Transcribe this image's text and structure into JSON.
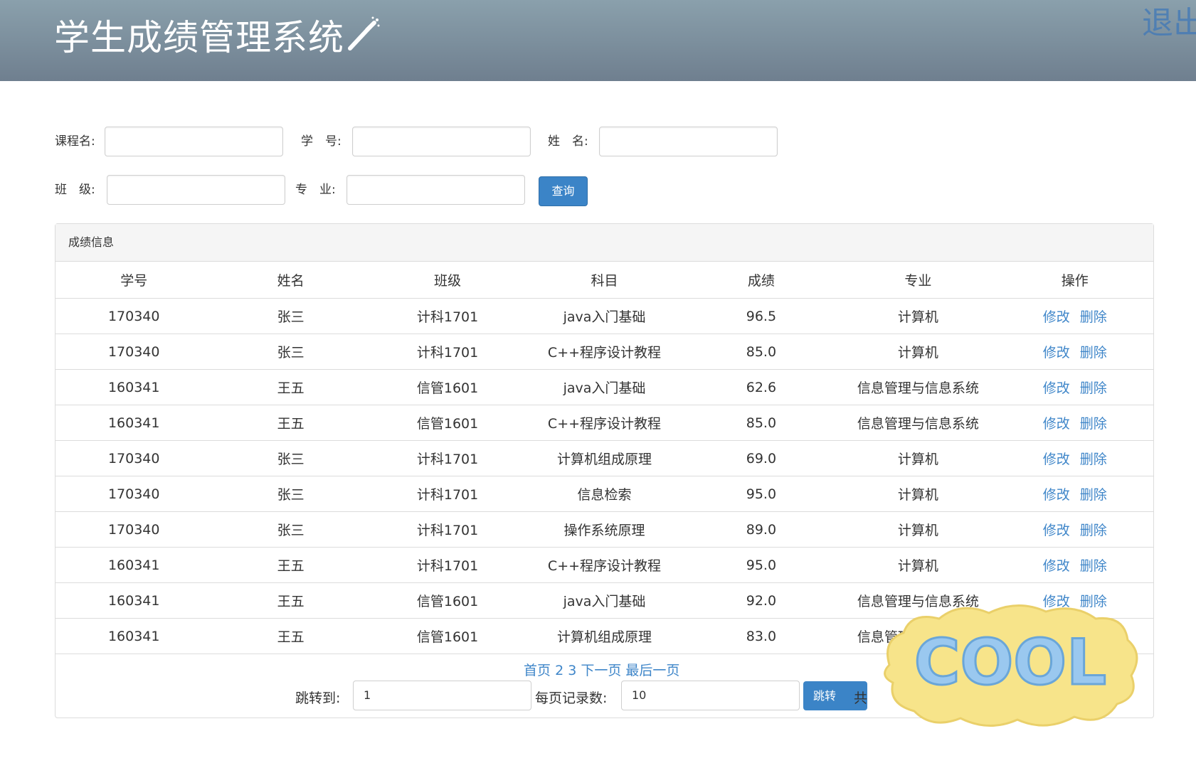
{
  "header": {
    "title": "学生成绩管理系统",
    "logout": "退出"
  },
  "search": {
    "course_label": "课程名:",
    "student_id_label": "学　号:",
    "name_label": "姓　名:",
    "class_label": "班　级:",
    "major_label": "专　业:",
    "query_button": "查询"
  },
  "panel": {
    "heading": "成绩信息",
    "columns": [
      "学号",
      "姓名",
      "班级",
      "科目",
      "成绩",
      "专业",
      "操作"
    ],
    "edit_label": "修改",
    "delete_label": "删除",
    "rows": [
      [
        "170340",
        "张三",
        "计科1701",
        "java入门基础",
        "96.5",
        "计算机"
      ],
      [
        "170340",
        "张三",
        "计科1701",
        "C++程序设计教程",
        "85.0",
        "计算机"
      ],
      [
        "160341",
        "王五",
        "信管1601",
        "java入门基础",
        "62.6",
        "信息管理与信息系统"
      ],
      [
        "160341",
        "王五",
        "信管1601",
        "C++程序设计教程",
        "85.0",
        "信息管理与信息系统"
      ],
      [
        "170340",
        "张三",
        "计科1701",
        "计算机组成原理",
        "69.0",
        "计算机"
      ],
      [
        "170340",
        "张三",
        "计科1701",
        "信息检索",
        "95.0",
        "计算机"
      ],
      [
        "170340",
        "张三",
        "计科1701",
        "操作系统原理",
        "89.0",
        "计算机"
      ],
      [
        "160341",
        "王五",
        "计科1701",
        "C++程序设计教程",
        "95.0",
        "计算机"
      ],
      [
        "160341",
        "王五",
        "信管1601",
        "java入门基础",
        "92.0",
        "信息管理与信息系统"
      ],
      [
        "160341",
        "王五",
        "信管1601",
        "计算机组成原理",
        "83.0",
        "信息管理与信息系统"
      ]
    ]
  },
  "pagination": {
    "first": "首页",
    "page2": "2",
    "page3": "3",
    "next": "下一页",
    "last": "最后一页",
    "jump_label": "跳转到:",
    "jump_value": "1",
    "page_size_label": "每页记录数:",
    "page_size_value": "10",
    "jump_button": "跳转",
    "total_text": "共"
  },
  "sticker": {
    "text": "COOL"
  }
}
